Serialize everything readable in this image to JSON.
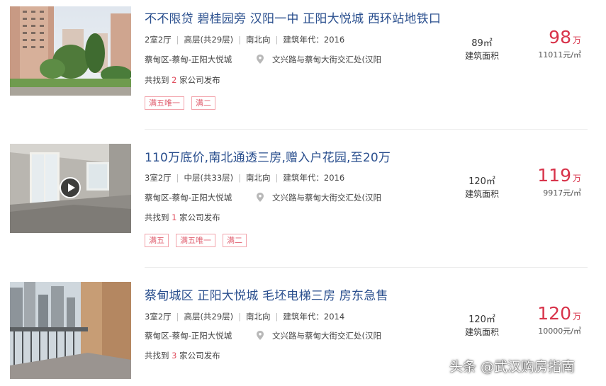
{
  "listings": [
    {
      "title": "不不限贷 碧桂园旁 汉阳一中 正阳大悦城 西环站地铁口",
      "layout": "2室2厅",
      "floor": "高层(共29层)",
      "orientation": "南北向",
      "year": "建筑年代：2016",
      "district": "蔡甸区-蔡甸-正阳大悦城",
      "address": "文兴路与蔡甸大街交汇处(汉阳",
      "publisher_prefix": "共找到",
      "publisher_count": "2",
      "publisher_suffix": "家公司发布",
      "tags": [
        "满五唯一",
        "满二"
      ],
      "area": "89㎡",
      "area_label": "建筑面积",
      "price": "98",
      "price_unit": "万",
      "unit_price": "11011元/㎡"
    },
    {
      "title": "110万底价,南北通透三房,赠入户花园,至20万",
      "layout": "3室2厅",
      "floor": "中层(共33层)",
      "orientation": "南北向",
      "year": "建筑年代：2016",
      "district": "蔡甸区-蔡甸-正阳大悦城",
      "address": "文兴路与蔡甸大街交汇处(汉阳",
      "publisher_prefix": "共找到",
      "publisher_count": "1",
      "publisher_suffix": "家公司发布",
      "tags": [
        "满五",
        "满五唯一",
        "满二"
      ],
      "area": "120㎡",
      "area_label": "建筑面积",
      "price": "119",
      "price_unit": "万",
      "unit_price": "9917元/㎡"
    },
    {
      "title": "蔡甸城区 正阳大悦城 毛坯电梯三房 房东急售",
      "layout": "3室2厅",
      "floor": "高层(共29层)",
      "orientation": "南北向",
      "year": "建筑年代：2014",
      "district": "蔡甸区-蔡甸-正阳大悦城",
      "address": "文兴路与蔡甸大街交汇处(汉阳",
      "publisher_prefix": "共找到",
      "publisher_count": "3",
      "publisher_suffix": "家公司发布",
      "tags": [],
      "area": "120㎡",
      "area_label": "建筑面积",
      "price": "120",
      "price_unit": "万",
      "unit_price": "10000元/㎡"
    }
  ],
  "icons": {
    "location": "map-pin-icon",
    "video": "play-icon"
  },
  "colors": {
    "title": "#2a4f8e",
    "price": "#d8334a",
    "tag_border": "#f2a3ab"
  },
  "watermark": "头条 @武汉购房指南"
}
